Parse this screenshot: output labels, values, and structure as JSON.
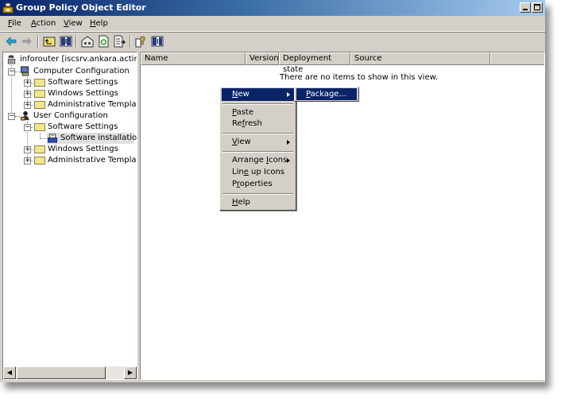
{
  "window": {
    "title": "Group Policy Object Editor",
    "app_icon": "gpedit-icon",
    "controls": [
      "minimize",
      "maximize"
    ]
  },
  "menubar": {
    "items": [
      {
        "label": "File",
        "accel": "F"
      },
      {
        "label": "Action",
        "accel": "A"
      },
      {
        "label": "View",
        "accel": "V"
      },
      {
        "label": "Help",
        "accel": "H"
      }
    ]
  },
  "toolbar": {
    "buttons": [
      {
        "name": "back",
        "icon": "back-arrow-icon"
      },
      {
        "name": "forward",
        "icon": "forward-arrow-icon"
      },
      {
        "name": "up-one-level",
        "icon": "up-folder-icon"
      },
      {
        "name": "show-hide-console-tree",
        "icon": "console-tree-icon"
      },
      {
        "name": "properties",
        "icon": "properties-icon"
      },
      {
        "name": "refresh",
        "icon": "refresh-icon"
      },
      {
        "name": "export-list",
        "icon": "export-list-icon"
      },
      {
        "name": "help",
        "icon": "help-icon"
      },
      {
        "name": "show-hide-action-pane",
        "icon": "action-pane-icon"
      }
    ]
  },
  "tree": {
    "root": "inforouter [iscsrv.ankara.actinn.co",
    "computer_config": {
      "label": "Computer Configuration",
      "children": [
        "Software Settings",
        "Windows Settings",
        "Administrative Templates"
      ]
    },
    "user_config": {
      "label": "User Configuration",
      "software_settings": "Software Settings",
      "software_installation": "Software installation",
      "windows_settings": "Windows Settings",
      "admin_templates": "Administrative Templates"
    }
  },
  "list": {
    "columns": [
      "Name",
      "Version",
      "Deployment state",
      "Source"
    ],
    "empty_message": "There are no items to show in this view."
  },
  "context_menu": {
    "items": [
      {
        "label": "New",
        "submenu": true,
        "highlighted": true
      },
      {
        "label": "Paste"
      },
      {
        "label": "Refresh"
      },
      {
        "label": "View",
        "submenu": true
      },
      {
        "label": "Arrange Icons",
        "submenu": true
      },
      {
        "label": "Line up Icons"
      },
      {
        "label": "Properties"
      },
      {
        "label": "Help"
      }
    ],
    "submenu_new": {
      "label": "Package...",
      "highlighted": true
    }
  },
  "colors": {
    "titlebar_start": "#0a246a",
    "titlebar_end": "#a6caf0",
    "menu_highlight": "#0a246a",
    "chrome": "#d4d0c8"
  }
}
